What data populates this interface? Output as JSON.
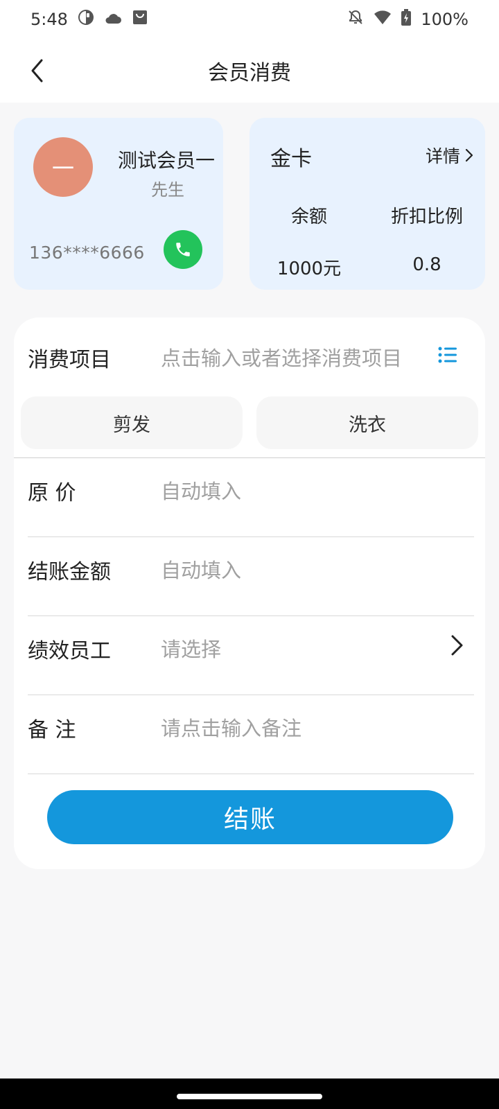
{
  "status_bar": {
    "time": "5:48",
    "battery": "100%",
    "icons_left": [
      "app-icon",
      "cloud-icon",
      "shopping-bag-icon"
    ],
    "icons_right": [
      "notifications-off-icon",
      "wifi-icon",
      "battery-charging-icon"
    ]
  },
  "header": {
    "title": "会员消费"
  },
  "member": {
    "avatar_text": "一",
    "name": "测试会员一",
    "gender": "先生",
    "phone": "136****6666"
  },
  "card": {
    "type": "金卡",
    "details_label": "详情",
    "balance_label": "余额",
    "balance_value": "1000元",
    "discount_label": "折扣比例",
    "discount_value": "0.8"
  },
  "form": {
    "item_label": "消费项目",
    "item_placeholder": "点击输入或者选择消费项目",
    "chips": [
      "剪发",
      "洗衣"
    ],
    "original_price_label": "原  价",
    "original_price_value": "自动填入",
    "checkout_amount_label": "结账金额",
    "checkout_amount_value": "自动填入",
    "staff_label": "绩效员工",
    "staff_placeholder": "请选择",
    "remark_label": "备  注",
    "remark_placeholder": "请点击输入备注",
    "submit_label": "结账"
  },
  "colors": {
    "accent": "#1497dc",
    "call_green": "#23c35b",
    "avatar": "#e49077",
    "card_bg": "#e8f2fe"
  }
}
